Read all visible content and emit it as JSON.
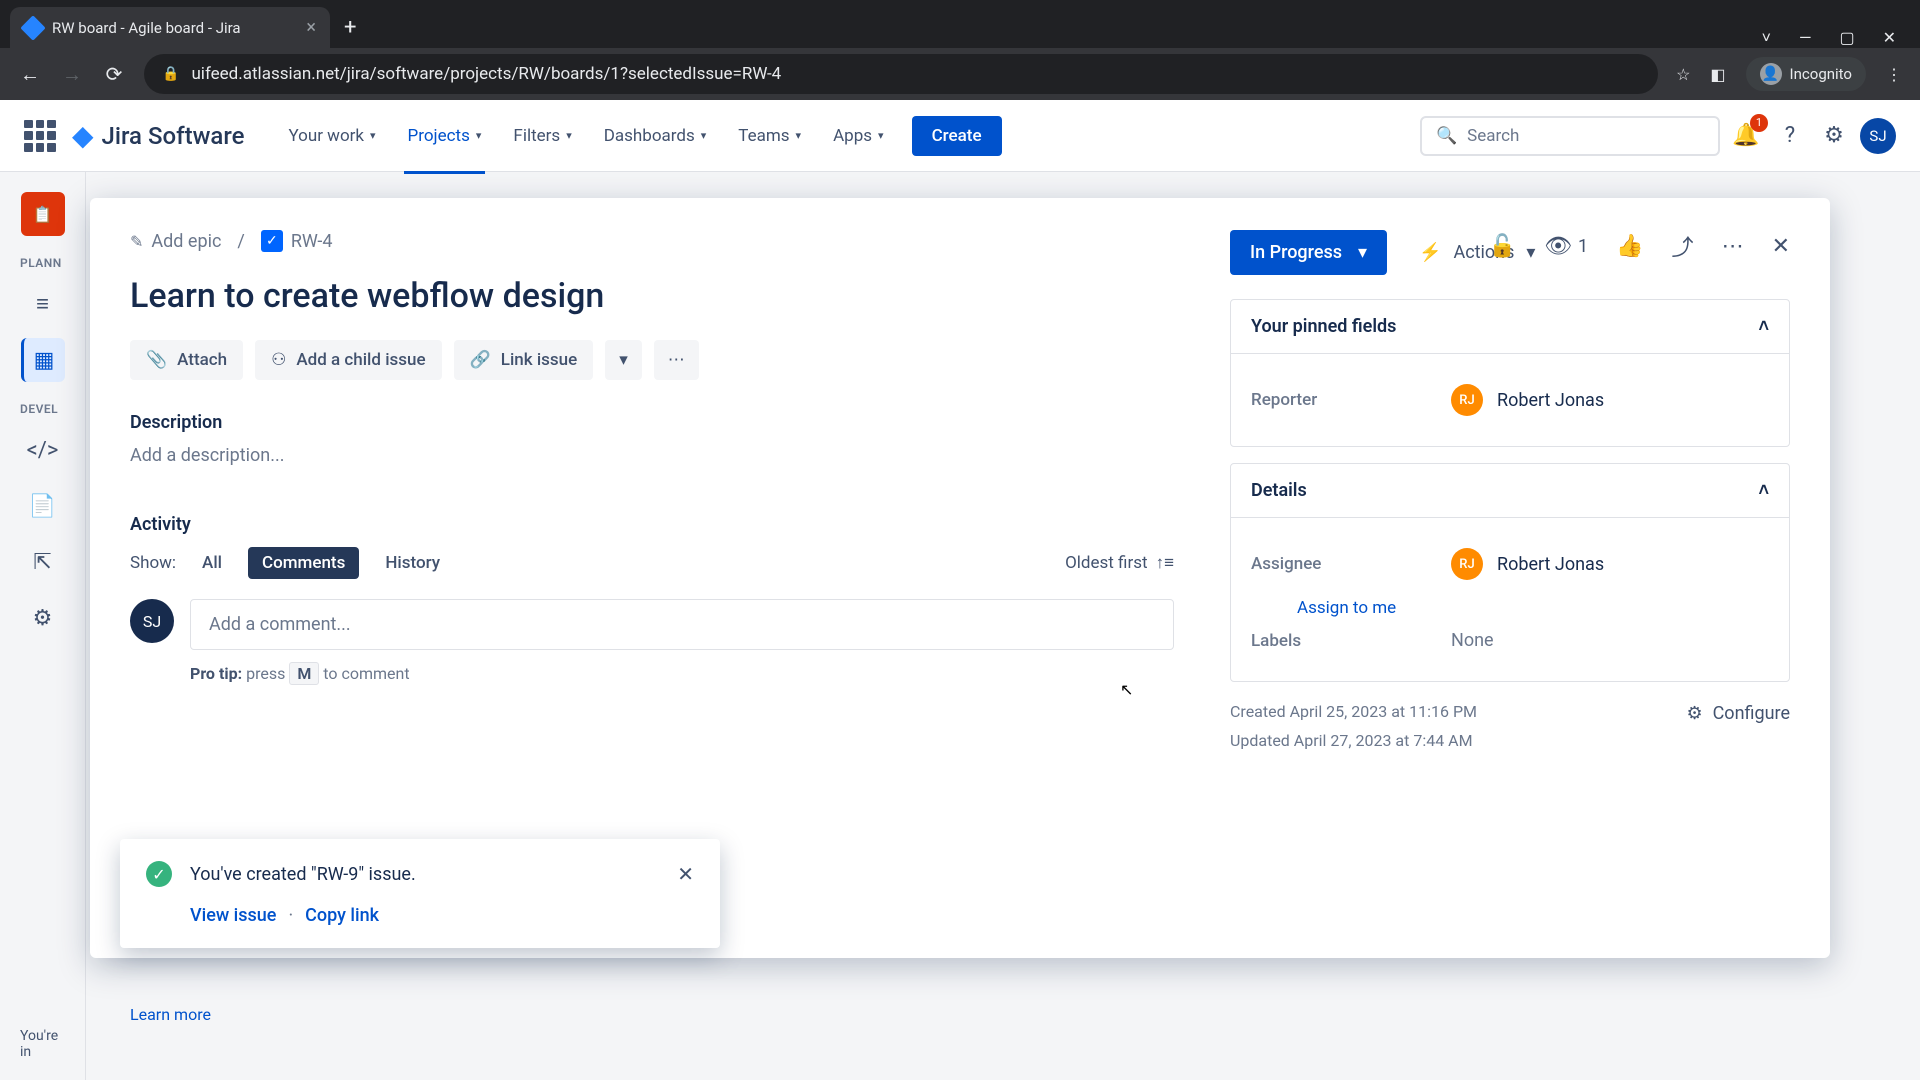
{
  "browser": {
    "tab_title": "RW board - Agile board - Jira",
    "url": "uifeed.atlassian.net/jira/software/projects/RW/boards/1?selectedIssue=RW-4",
    "incognito_label": "Incognito"
  },
  "nav": {
    "logo_text": "Jira Software",
    "items": [
      "Your work",
      "Projects",
      "Filters",
      "Dashboards",
      "Teams",
      "Apps"
    ],
    "active_index": 1,
    "create_label": "Create",
    "search_placeholder": "Search",
    "notification_count": "1",
    "user_initials": "SJ"
  },
  "sidebar": {
    "section1": "PLANN",
    "section2": "DEVEL",
    "footer_line1": "You're in",
    "footer_link": "Learn more"
  },
  "issue": {
    "breadcrumb_add_epic": "Add epic",
    "breadcrumb_sep": "/",
    "issue_key": "RW-4",
    "watch_count": "1",
    "title": "Learn to create webflow design",
    "attach_label": "Attach",
    "add_child_label": "Add a child issue",
    "link_issue_label": "Link issue",
    "description_heading": "Description",
    "description_placeholder": "Add a description...",
    "activity_heading": "Activity",
    "show_label": "Show:",
    "tabs": [
      "All",
      "Comments",
      "History"
    ],
    "active_tab_index": 1,
    "sort_label": "Oldest first",
    "comment_avatar": "SJ",
    "comment_placeholder": "Add a comment...",
    "pro_tip_label": "Pro tip:",
    "pro_tip_press": "press",
    "pro_tip_key": "M",
    "pro_tip_rest": "to comment"
  },
  "right_panel": {
    "status_label": "In Progress",
    "actions_label": "Actions",
    "pinned_heading": "Your pinned fields",
    "reporter_label": "Reporter",
    "reporter_initials": "RJ",
    "reporter_name": "Robert Jonas",
    "details_heading": "Details",
    "assignee_label": "Assignee",
    "assignee_initials": "RJ",
    "assignee_name": "Robert Jonas",
    "assign_to_me": "Assign to me",
    "labels_label": "Labels",
    "labels_value": "None",
    "created_text": "Created April 25, 2023 at 11:16 PM",
    "updated_text": "Updated April 27, 2023 at 7:44 AM",
    "configure_label": "Configure"
  },
  "toast": {
    "message": "You've created \"RW-9\" issue.",
    "view_link": "View issue",
    "copy_link": "Copy link",
    "sep": "·"
  }
}
